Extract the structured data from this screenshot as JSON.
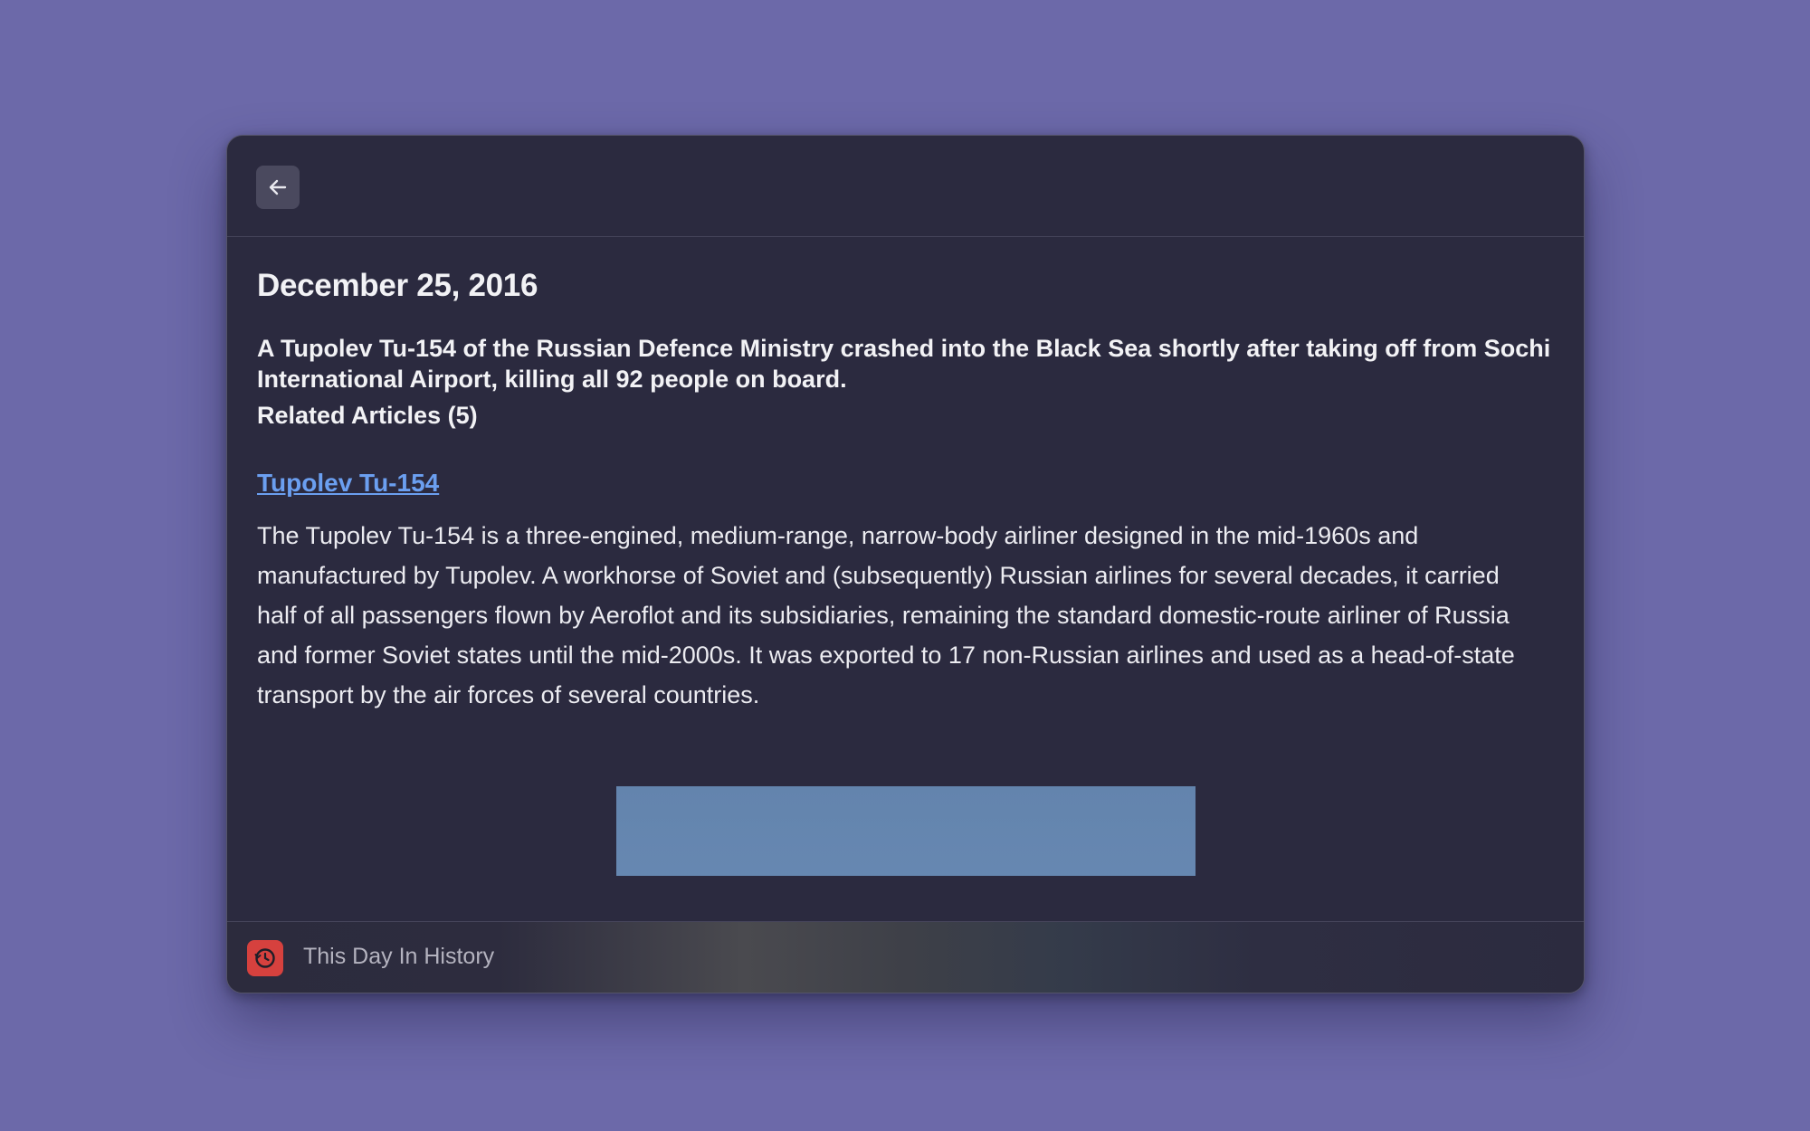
{
  "window": {
    "back_icon": "arrow-left-icon"
  },
  "event": {
    "date": "December 25, 2016",
    "summary": "A Tupolev Tu-154 of the Russian Defence Ministry crashed into the Black Sea shortly after taking off from Sochi International Airport, killing all 92 people on board.",
    "related_heading": "Related Articles (5)"
  },
  "article": {
    "title": "Tupolev Tu-154",
    "text": "The Tupolev Tu-154 is a three-engined, medium-range, narrow-body airliner designed in the mid-1960s and manufactured by Tupolev. A workhorse of Soviet and (subsequently) Russian airlines for several decades, it carried half of all passengers flown by Aeroflot and its subsidiaries, remaining the standard domestic-route airliner of Russia and former Soviet states until the mid-2000s. It was exported to 17 non-Russian airlines and used as a head-of-state transport by the air forces of several countries."
  },
  "footer": {
    "app_name": "This Day In History",
    "app_icon": "history-clock-icon",
    "accent": "#d6413e"
  },
  "colors": {
    "background": "#6c69a9",
    "window": "#2b2a3f",
    "link": "#6b9ff0"
  }
}
